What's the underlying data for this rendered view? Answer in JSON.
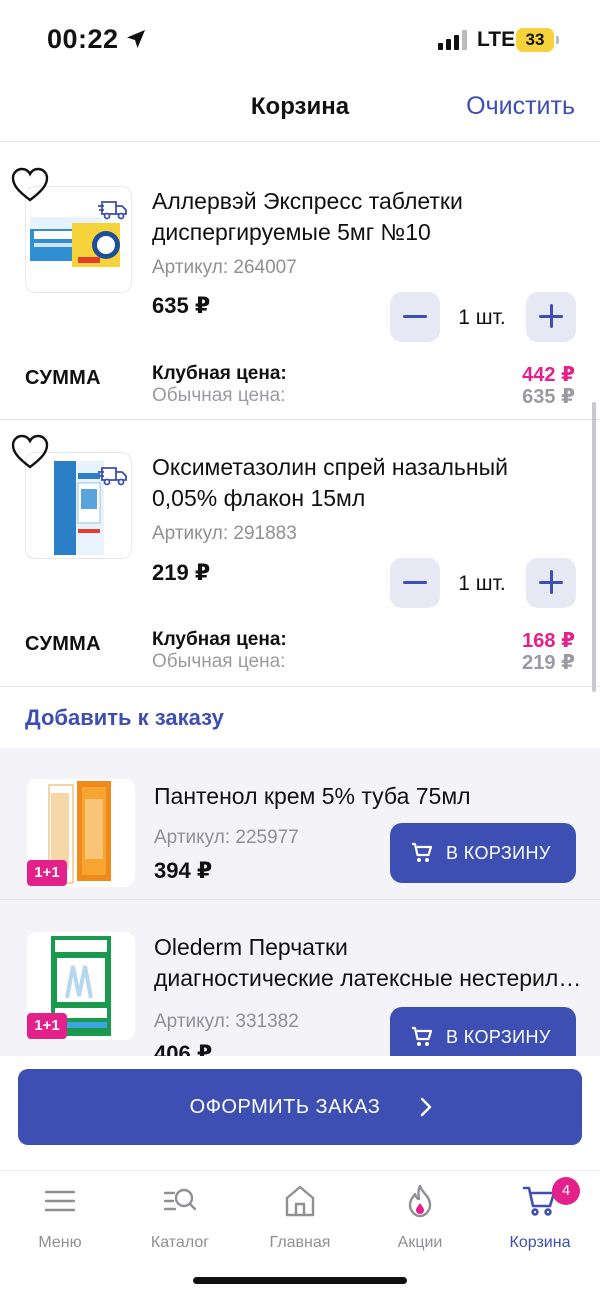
{
  "status": {
    "time": "00:22",
    "network": "LTE",
    "battery": "33"
  },
  "header": {
    "title": "Корзина",
    "clear_label": "Очистить"
  },
  "cart": {
    "items": [
      {
        "title": "Аллервэй Экспресс таблетки диспергируемые 5мг №10",
        "sku": "Артикул: 264007",
        "price": "635 ₽",
        "quantity": "1 шт.",
        "sum_label": "СУММА",
        "club_label": "Клубная цена:",
        "regular_label": "Обычная цена:",
        "club_price": "442 ₽",
        "regular_price": "635 ₽"
      },
      {
        "title": "Оксиметазолин спрей назальный 0,05% флакон 15мл",
        "sku": "Артикул: 291883",
        "price": "219 ₽",
        "quantity": "1 шт.",
        "sum_label": "СУММА",
        "club_label": "Клубная цена:",
        "regular_label": "Обычная цена:",
        "club_price": "168 ₽",
        "regular_price": "219 ₽"
      }
    ]
  },
  "add_to_order": {
    "title": "Добавить к заказу",
    "items": [
      {
        "title": "Пантенол крем 5% туба 75мл",
        "sku": "Артикул: 225977",
        "price": "394 ₽",
        "badge": "1+1",
        "button_label": "В КОРЗИНУ"
      },
      {
        "title_line1": "Olederm Перчатки",
        "title_line2": "диагностические латексные нестерильные",
        "sku": "Артикул: 331382",
        "price": "406 ₽",
        "badge": "1+1",
        "button_label": "В КОРЗИНУ"
      }
    ]
  },
  "checkout": {
    "label": "ОФОРМИТЬ ЗАКАЗ"
  },
  "tabbar": {
    "tabs": [
      {
        "label": "Меню",
        "icon": "menu-icon"
      },
      {
        "label": "Каталог",
        "icon": "catalog-search-icon"
      },
      {
        "label": "Главная",
        "icon": "home-icon"
      },
      {
        "label": "Акции",
        "icon": "flame-icon"
      },
      {
        "label": "Корзина",
        "icon": "cart-icon",
        "badge": "4",
        "active": true
      }
    ]
  },
  "colors": {
    "accent": "#3d4fb2",
    "club_price": "#e4208a",
    "muted": "#9a9ba2"
  }
}
